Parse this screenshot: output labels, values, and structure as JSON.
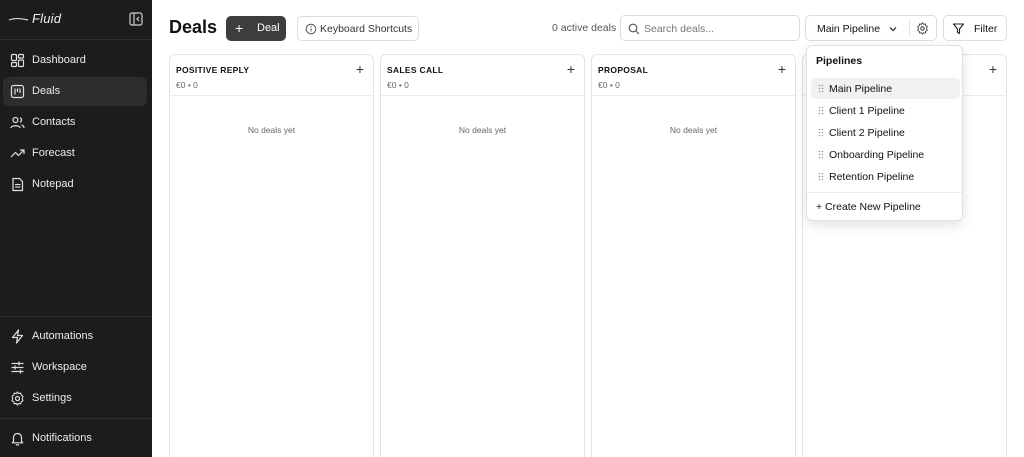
{
  "brand": {
    "name": "Fluid"
  },
  "sidebar": {
    "main_items": [
      {
        "label": "Dashboard",
        "icon": "dashboard-icon",
        "active": false
      },
      {
        "label": "Deals",
        "icon": "kanban-icon",
        "active": true
      },
      {
        "label": "Contacts",
        "icon": "users-icon",
        "active": false
      },
      {
        "label": "Forecast",
        "icon": "trending-up-icon",
        "active": false
      },
      {
        "label": "Notepad",
        "icon": "file-text-icon",
        "active": false
      }
    ],
    "bottom_items": [
      {
        "label": "Automations",
        "icon": "zap-icon"
      },
      {
        "label": "Workspace",
        "icon": "sliders-icon"
      },
      {
        "label": "Settings",
        "icon": "gear-icon"
      }
    ],
    "notifications": {
      "label": "Notifications",
      "icon": "bell-icon"
    }
  },
  "header": {
    "title": "Deals",
    "deal_button": "Deal",
    "shortcuts_button": "Keyboard Shortcuts",
    "active_deals": "0 active deals",
    "search_placeholder": "Search deals...",
    "pipeline_selected": "Main Pipeline",
    "filter_button": "Filter"
  },
  "columns": [
    {
      "title": "POSITIVE REPLY",
      "meta": "€0 • 0",
      "empty": "No deals yet"
    },
    {
      "title": "SALES CALL",
      "meta": "€0 • 0",
      "empty": "No deals yet"
    },
    {
      "title": "PROPOSAL",
      "meta": "€0 • 0",
      "empty": "No deals yet"
    },
    {
      "title": "",
      "meta": "",
      "empty": ""
    }
  ],
  "pipelines_menu": {
    "title": "Pipelines",
    "items": [
      {
        "label": "Main Pipeline",
        "selected": true
      },
      {
        "label": "Client 1 Pipeline",
        "selected": false
      },
      {
        "label": "Client 2 Pipeline",
        "selected": false
      },
      {
        "label": "Onboarding Pipeline",
        "selected": false
      },
      {
        "label": "Retention Pipeline",
        "selected": false
      }
    ],
    "create_label": "+ Create New Pipeline"
  },
  "colors": {
    "sidebar_bg": "#1c1c1c",
    "active_item_bg": "#2d2d2d",
    "primary_button": "#3d3d3d"
  }
}
